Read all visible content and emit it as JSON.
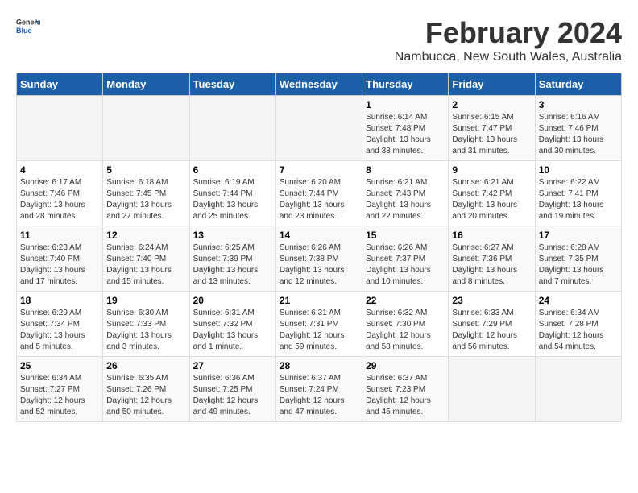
{
  "logo": {
    "line1": "General",
    "line2": "Blue"
  },
  "title": "February 2024",
  "subtitle": "Nambucca, New South Wales, Australia",
  "days_of_week": [
    "Sunday",
    "Monday",
    "Tuesday",
    "Wednesday",
    "Thursday",
    "Friday",
    "Saturday"
  ],
  "weeks": [
    [
      {
        "day": "",
        "info": ""
      },
      {
        "day": "",
        "info": ""
      },
      {
        "day": "",
        "info": ""
      },
      {
        "day": "",
        "info": ""
      },
      {
        "day": "1",
        "info": "Sunrise: 6:14 AM\nSunset: 7:48 PM\nDaylight: 13 hours\nand 33 minutes."
      },
      {
        "day": "2",
        "info": "Sunrise: 6:15 AM\nSunset: 7:47 PM\nDaylight: 13 hours\nand 31 minutes."
      },
      {
        "day": "3",
        "info": "Sunrise: 6:16 AM\nSunset: 7:46 PM\nDaylight: 13 hours\nand 30 minutes."
      }
    ],
    [
      {
        "day": "4",
        "info": "Sunrise: 6:17 AM\nSunset: 7:46 PM\nDaylight: 13 hours\nand 28 minutes."
      },
      {
        "day": "5",
        "info": "Sunrise: 6:18 AM\nSunset: 7:45 PM\nDaylight: 13 hours\nand 27 minutes."
      },
      {
        "day": "6",
        "info": "Sunrise: 6:19 AM\nSunset: 7:44 PM\nDaylight: 13 hours\nand 25 minutes."
      },
      {
        "day": "7",
        "info": "Sunrise: 6:20 AM\nSunset: 7:44 PM\nDaylight: 13 hours\nand 23 minutes."
      },
      {
        "day": "8",
        "info": "Sunrise: 6:21 AM\nSunset: 7:43 PM\nDaylight: 13 hours\nand 22 minutes."
      },
      {
        "day": "9",
        "info": "Sunrise: 6:21 AM\nSunset: 7:42 PM\nDaylight: 13 hours\nand 20 minutes."
      },
      {
        "day": "10",
        "info": "Sunrise: 6:22 AM\nSunset: 7:41 PM\nDaylight: 13 hours\nand 19 minutes."
      }
    ],
    [
      {
        "day": "11",
        "info": "Sunrise: 6:23 AM\nSunset: 7:40 PM\nDaylight: 13 hours\nand 17 minutes."
      },
      {
        "day": "12",
        "info": "Sunrise: 6:24 AM\nSunset: 7:40 PM\nDaylight: 13 hours\nand 15 minutes."
      },
      {
        "day": "13",
        "info": "Sunrise: 6:25 AM\nSunset: 7:39 PM\nDaylight: 13 hours\nand 13 minutes."
      },
      {
        "day": "14",
        "info": "Sunrise: 6:26 AM\nSunset: 7:38 PM\nDaylight: 13 hours\nand 12 minutes."
      },
      {
        "day": "15",
        "info": "Sunrise: 6:26 AM\nSunset: 7:37 PM\nDaylight: 13 hours\nand 10 minutes."
      },
      {
        "day": "16",
        "info": "Sunrise: 6:27 AM\nSunset: 7:36 PM\nDaylight: 13 hours\nand 8 minutes."
      },
      {
        "day": "17",
        "info": "Sunrise: 6:28 AM\nSunset: 7:35 PM\nDaylight: 13 hours\nand 7 minutes."
      }
    ],
    [
      {
        "day": "18",
        "info": "Sunrise: 6:29 AM\nSunset: 7:34 PM\nDaylight: 13 hours\nand 5 minutes."
      },
      {
        "day": "19",
        "info": "Sunrise: 6:30 AM\nSunset: 7:33 PM\nDaylight: 13 hours\nand 3 minutes."
      },
      {
        "day": "20",
        "info": "Sunrise: 6:31 AM\nSunset: 7:32 PM\nDaylight: 13 hours\nand 1 minute."
      },
      {
        "day": "21",
        "info": "Sunrise: 6:31 AM\nSunset: 7:31 PM\nDaylight: 12 hours\nand 59 minutes."
      },
      {
        "day": "22",
        "info": "Sunrise: 6:32 AM\nSunset: 7:30 PM\nDaylight: 12 hours\nand 58 minutes."
      },
      {
        "day": "23",
        "info": "Sunrise: 6:33 AM\nSunset: 7:29 PM\nDaylight: 12 hours\nand 56 minutes."
      },
      {
        "day": "24",
        "info": "Sunrise: 6:34 AM\nSunset: 7:28 PM\nDaylight: 12 hours\nand 54 minutes."
      }
    ],
    [
      {
        "day": "25",
        "info": "Sunrise: 6:34 AM\nSunset: 7:27 PM\nDaylight: 12 hours\nand 52 minutes."
      },
      {
        "day": "26",
        "info": "Sunrise: 6:35 AM\nSunset: 7:26 PM\nDaylight: 12 hours\nand 50 minutes."
      },
      {
        "day": "27",
        "info": "Sunrise: 6:36 AM\nSunset: 7:25 PM\nDaylight: 12 hours\nand 49 minutes."
      },
      {
        "day": "28",
        "info": "Sunrise: 6:37 AM\nSunset: 7:24 PM\nDaylight: 12 hours\nand 47 minutes."
      },
      {
        "day": "29",
        "info": "Sunrise: 6:37 AM\nSunset: 7:23 PM\nDaylight: 12 hours\nand 45 minutes."
      },
      {
        "day": "",
        "info": ""
      },
      {
        "day": "",
        "info": ""
      }
    ]
  ]
}
